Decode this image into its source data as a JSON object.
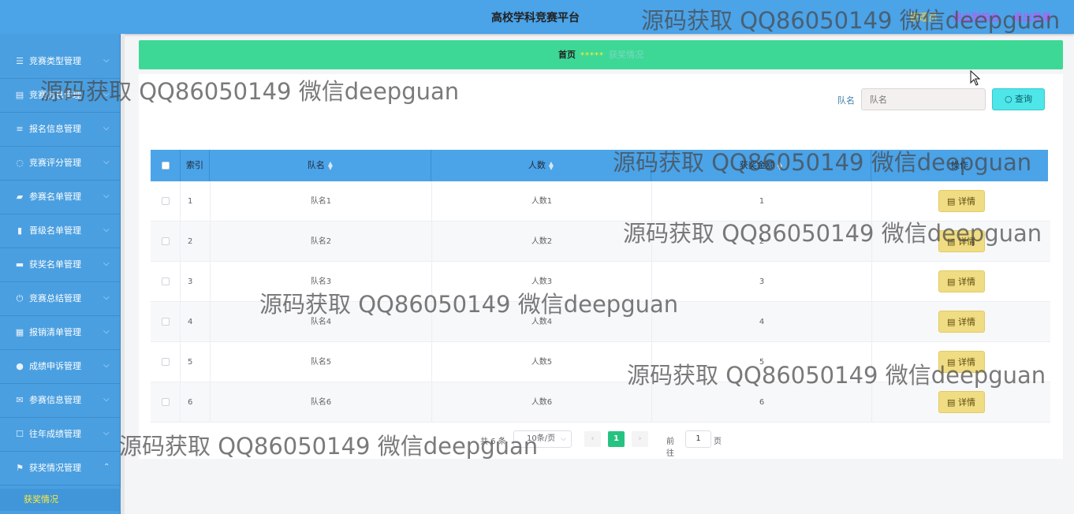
{
  "header": {
    "title": "高校学科竞赛平台",
    "user": "管理员",
    "link_front": "退出到前台",
    "link_logout": "退出登录"
  },
  "sidebar": {
    "items": [
      {
        "label": "竞赛类型管理",
        "icon": "list-icon"
      },
      {
        "label": "竞赛信息管理",
        "icon": "document-icon"
      },
      {
        "label": "报名信息管理",
        "icon": "sliders-icon"
      },
      {
        "label": "竞赛评分管理",
        "icon": "clock-icon"
      },
      {
        "label": "参赛名单管理",
        "icon": "briefcase-icon"
      },
      {
        "label": "晋级名单管理",
        "icon": "bar-chart-icon"
      },
      {
        "label": "获奖名单管理",
        "icon": "printer-icon"
      },
      {
        "label": "竞赛总结管理",
        "icon": "power-icon"
      },
      {
        "label": "报销清单管理",
        "icon": "grid-icon"
      },
      {
        "label": "成绩申诉管理",
        "icon": "pin-icon"
      },
      {
        "label": "参赛信息管理",
        "icon": "mail-icon"
      },
      {
        "label": "往年成绩管理",
        "icon": "box-icon"
      },
      {
        "label": "获奖情况管理",
        "icon": "flag-icon",
        "expanded": true
      }
    ],
    "sub_item": "获奖情况"
  },
  "breadcrumb": {
    "home": "首页",
    "separator": "*****",
    "current": "获奖情况"
  },
  "search": {
    "label": "队名",
    "placeholder": "队名",
    "button": "查询"
  },
  "table": {
    "columns": [
      "索引",
      "队名",
      "人数",
      "获奖金额",
      "操作"
    ],
    "rows": [
      {
        "index": "1",
        "team": "队名1",
        "count": "人数1",
        "amount": "1"
      },
      {
        "index": "2",
        "team": "队名2",
        "count": "人数2",
        "amount": "2"
      },
      {
        "index": "3",
        "team": "队名3",
        "count": "人数3",
        "amount": "3"
      },
      {
        "index": "4",
        "team": "队名4",
        "count": "人数4",
        "amount": "4"
      },
      {
        "index": "5",
        "team": "队名5",
        "count": "人数5",
        "amount": "5"
      },
      {
        "index": "6",
        "team": "队名6",
        "count": "人数6",
        "amount": "6"
      }
    ],
    "detail_label": "详情"
  },
  "pagination": {
    "total": "共 6 条",
    "page_size": "10条/页",
    "current_page": "1",
    "goto_prefix": "前往",
    "goto_value": "1",
    "goto_suffix": "页"
  },
  "watermark": "源码获取 QQ86050149 微信deepguan",
  "colors": {
    "header": "#4ba3e8",
    "sidebar": "#4a9fe0",
    "breadcrumb": "#3ed896",
    "search_button": "#4ee6e8",
    "detail_button": "#f0dc82",
    "active_page": "#26c281"
  }
}
